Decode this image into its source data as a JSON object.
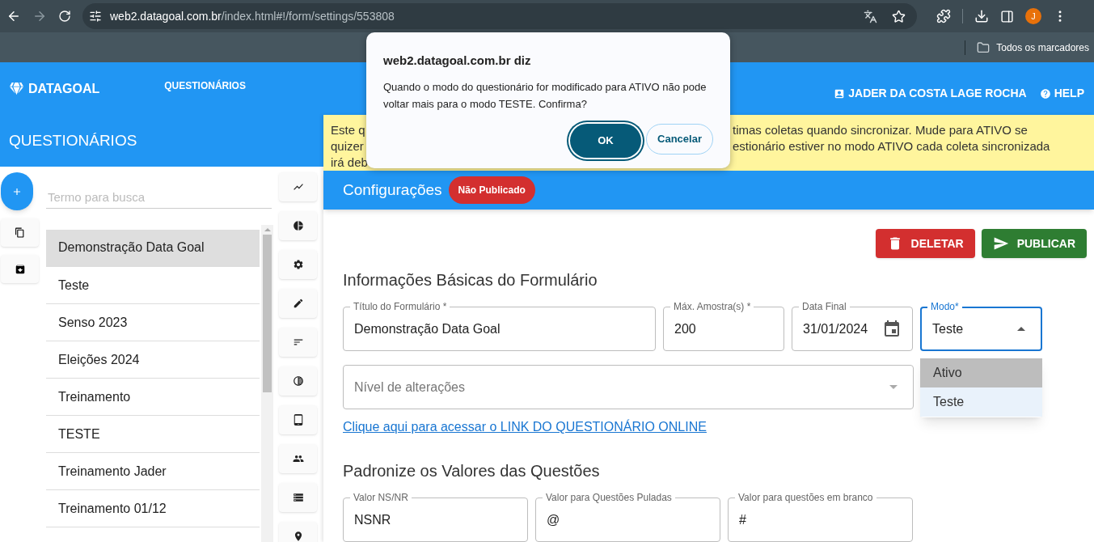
{
  "browser": {
    "address_host": "web2.datagoal.com.br",
    "address_path": "/index.html#!/form/settings/553808",
    "bookmarks_label": "Todos os marcadores",
    "profile_initial": "J"
  },
  "header": {
    "logo": "DATAGOAL",
    "nav": [
      "QUESTIONÁRIOS"
    ],
    "user": "JADER DA COSTA LAGE ROCHA",
    "help": "HELP"
  },
  "sidebar": {
    "title": "QUESTIONÁRIOS",
    "search_placeholder": "Termo para busca",
    "items": [
      {
        "label": "Demonstração Data Goal",
        "selected": true
      },
      {
        "label": "Teste",
        "selected": false
      },
      {
        "label": "Senso 2023",
        "selected": false
      },
      {
        "label": "Eleições 2024",
        "selected": false
      },
      {
        "label": "Treinamento",
        "selected": false
      },
      {
        "label": "TESTE",
        "selected": false
      },
      {
        "label": "Treinamento Jader",
        "selected": false
      },
      {
        "label": "Treinamento 01/12",
        "selected": false
      }
    ]
  },
  "banner": {
    "left_fragments": [
      "Este q",
      "quizer",
      "irá deb"
    ],
    "right_fragments": [
      "timas coletas quando sincronizar. Mude para ATIVO se",
      "estionário estiver no modo ATIVO cada coleta sincronizada"
    ]
  },
  "section": {
    "title": "Configurações",
    "badge": "Não Publicado"
  },
  "actions": [
    {
      "label": "DELETAR",
      "kind": "delete"
    },
    {
      "label": "PUBLICAR",
      "kind": "publish"
    }
  ],
  "basic": {
    "title": "Informações Básicas do Formulário",
    "fields": [
      {
        "label": "Título do Formulário *",
        "value": "Demonstração Data Goal",
        "kind": "text"
      },
      {
        "label": "Máx. Amostra(s) *",
        "value": "200",
        "kind": "text"
      },
      {
        "label": "Data Final",
        "value": "31/01/2024",
        "kind": "date"
      }
    ],
    "mode": {
      "label": "Modo*",
      "value": "Teste",
      "expanded": true,
      "options": [
        {
          "label": "Ativo",
          "hovered": true,
          "selected": false
        },
        {
          "label": "Teste",
          "hovered": false,
          "selected": true
        }
      ]
    },
    "level_select": {
      "placeholder": "Nível de alterações"
    },
    "link": "Clique aqui para acessar o LINK DO QUESTIONÁRIO ONLINE"
  },
  "defaults": {
    "title": "Padronize os Valores das Questões",
    "fields": [
      {
        "label": "Valor NS/NR",
        "value": "NSNR"
      },
      {
        "label": "Valor para Questões Puladas",
        "value": "@"
      },
      {
        "label": "Valor para questões em branco",
        "value": "#"
      }
    ]
  },
  "dialog": {
    "title": "web2.datagoal.com.br diz",
    "message": "Quando o modo do questionário for modificado para ATIVO não pode voltar mais para o modo TESTE. Confirma?",
    "buttons": [
      {
        "label": "OK",
        "kind": "primary"
      },
      {
        "label": "Cancelar",
        "kind": "secondary"
      }
    ]
  }
}
